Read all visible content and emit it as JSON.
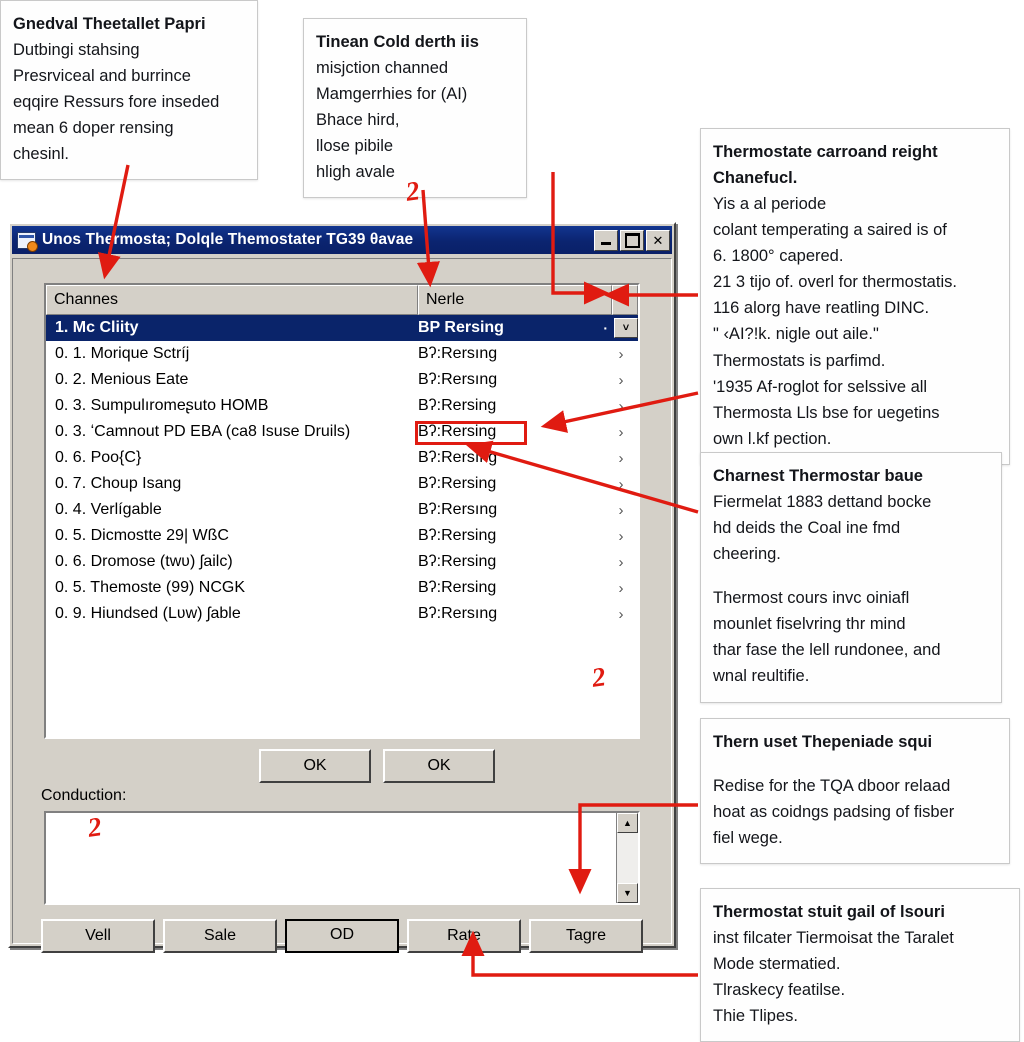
{
  "theme": {
    "accent": "#e01b11",
    "titlebar": "#0b2470",
    "selection": "#0a246a",
    "face": "#d4d0c8"
  },
  "callouts": {
    "top_left": {
      "heading": "Gnedval Theetallet Papri",
      "lines": [
        "Dutbingi stahsing",
        "Presrviceal and burrince",
        "eqqire Ressurs fore inseded",
        "mean 6 doper rensing",
        "chesinl."
      ]
    },
    "top_mid": {
      "heading": "Tinean Cold derth iis",
      "lines": [
        "misjction channed",
        "Mamgerrhies for (AI)",
        "Bhace hird,",
        "llose pibile",
        "hligh avale"
      ]
    },
    "right_1": {
      "heading": "Thermostate carroand reight Chanefucl.",
      "lines": [
        "Yis a al periode",
        "colant  temperating a  saired is of",
        "6. 1800° capered.",
        "21 3  tijo of. overl for thermostatis.",
        "116 alorg have reatling DINC.",
        "\" ‹AI?!k. nigle out aile.\"",
        "Thermostats is parfimd.",
        "'1935 Af-roglot for selssive all",
        "Thermosta Lls bse for uegetins",
        "own l.kf pection."
      ]
    },
    "right_2": {
      "heading": "Charnest Thermostar baue",
      "lines": [
        "Fiermelat 1883 dettand bocke",
        "hd deids the Coal ine fmd",
        "cheering."
      ],
      "lines2": [
        "Thermost cours invc oiniafl",
        "mounlet fiselvring thr mind",
        "thar fase the lell rundonee, and",
        "wnal reultifie."
      ]
    },
    "right_3": {
      "heading": "Thern uset Thepeniade squi",
      "lines": [
        "Redise for the TQA dboor relaad",
        "hoat as coidngs padsing of fisber",
        "fiel wege."
      ]
    },
    "right_4": {
      "heading": "Thermostat stuit gail of lsouri",
      "lines": [
        "inst filcater Tiermoisat the Taralet",
        "Mode stermatied.",
        "Tlraskecy featilse.",
        "Thie Tlipes."
      ]
    }
  },
  "hand_marks": {
    "mark_a": "2",
    "mark_b": "2",
    "mark_c": "2"
  },
  "dialog": {
    "title": "Unos Thermosta; Dolqle Themostater TG39 θavae",
    "window_buttons": {
      "minimize": "_",
      "maximize": "□",
      "close": "✕"
    },
    "list": {
      "columns": [
        "Channes",
        "Nerle"
      ],
      "rows": [
        {
          "name": "1. Mc Cliity",
          "value": "BP Rersing",
          "chevron": "˅",
          "selected": true
        },
        {
          "name": "0. 1. Morique Sctríj",
          "value": "Bʔ:Rersıng",
          "chevron": "›",
          "selected": false
        },
        {
          "name": "0. 2. Menious Eate",
          "value": "Bʔ:Rersıng",
          "chevron": "›",
          "selected": false
        },
        {
          "name": "0. 3. Sumpulıromeʂuto HOMB",
          "value": "Bʔ:Rersing",
          "chevron": "›",
          "selected": false
        },
        {
          "name": "0. 3. ʻCamnout PD EBA (ca8 Isuse Druils)",
          "value": "Bʔ:Rersing",
          "chevron": "›",
          "selected": false,
          "highlight": true
        },
        {
          "name": "0. 6. Poo{C}",
          "value": "Bʔ:Rersıng",
          "chevron": "›",
          "selected": false
        },
        {
          "name": "0. 7. Choup Isang",
          "value": "Bʔ:Rersing",
          "chevron": "›",
          "selected": false
        },
        {
          "name": "0. 4. Verlígable",
          "value": "Bʔ:Rersıng",
          "chevron": "›",
          "selected": false
        },
        {
          "name": "0. 5. Dicmostte 29| WßC",
          "value": "Bʔ:Rersing",
          "chevron": "›",
          "selected": false
        },
        {
          "name": "0. 6. Dromose (twʋ) ʃailc)",
          "value": "Bʔ:Rersing",
          "chevron": "›",
          "selected": false
        },
        {
          "name": "0. 5. Themoste (99) NCGK",
          "value": "Bʔ:Rersing",
          "chevron": "›",
          "selected": false
        },
        {
          "name": "0. 9. Hiundsed (Lʋw) ʃable",
          "value": "Bʔ:Rersıng",
          "chevron": "›",
          "selected": false
        }
      ]
    },
    "mid_buttons": [
      "OK",
      "OK"
    ],
    "conduction_label": "Conduction:",
    "memo_value": "",
    "scrollbar": {
      "up": "▲",
      "down": "▼"
    },
    "bottom_buttons": [
      {
        "label": "Vell",
        "focused": false
      },
      {
        "label": "Sale",
        "focused": false
      },
      {
        "label": "OD",
        "focused": true
      },
      {
        "label": "Rate",
        "focused": false
      },
      {
        "label": "Tagre",
        "focused": false
      }
    ]
  }
}
